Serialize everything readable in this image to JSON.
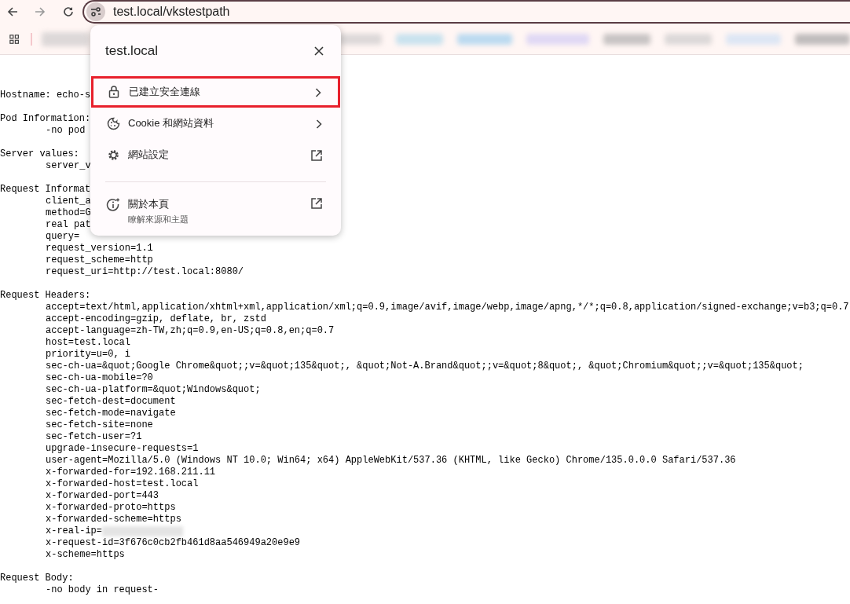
{
  "browser": {
    "url": "test.local/vkstestpath"
  },
  "page": {
    "sections": [
      {
        "heading": "Hostname: echo-s"
      },
      {
        "heading": "Pod Information:",
        "lines": [
          "-no pod"
        ]
      },
      {
        "heading": "Server values:",
        "lines": [
          "server_v"
        ]
      },
      {
        "heading": "Request Informat",
        "lines": [
          "client_a",
          "method=G",
          "real pat",
          "query=",
          "request_version=1.1",
          "request_scheme=http",
          "request_uri=http://test.local:8080/"
        ]
      },
      {
        "heading": "Request Headers:",
        "lines": [
          "accept=text/html,application/xhtml+xml,application/xml;q=0.9,image/avif,image/webp,image/apng,*/*;q=0.8,application/signed-exchange;v=b3;q=0.7",
          "accept-encoding=gzip, deflate, br, zstd",
          "accept-language=zh-TW,zh;q=0.9,en-US;q=0.8,en;q=0.7",
          "host=test.local",
          "priority=u=0, i",
          "sec-ch-ua=&quot;Google Chrome&quot;;v=&quot;135&quot;, &quot;Not-A.Brand&quot;;v=&quot;8&quot;, &quot;Chromium&quot;;v=&quot;135&quot;",
          "sec-ch-ua-mobile=?0",
          "sec-ch-ua-platform=&quot;Windows&quot;",
          "sec-fetch-dest=document",
          "sec-fetch-mode=navigate",
          "sec-fetch-site=none",
          "sec-fetch-user=?1",
          "upgrade-insecure-requests=1",
          "user-agent=Mozilla/5.0 (Windows NT 10.0; Win64; x64) AppleWebKit/537.36 (KHTML, like Gecko) Chrome/135.0.0.0 Safari/537.36",
          "x-forwarded-for=192.168.211.11",
          "x-forwarded-host=test.local",
          "x-forwarded-port=443",
          "x-forwarded-proto=https",
          "x-forwarded-scheme=https",
          "x-real-ip=",
          "x-request-id=3f676c0cb2fb461d8aa546949a20e9e9",
          "x-scheme=https"
        ]
      },
      {
        "heading": "Request Body:",
        "lines": [
          "-no body in request-"
        ]
      }
    ]
  },
  "site_popup": {
    "title": "test.local",
    "items": [
      {
        "kind": "submenu",
        "label": "已建立安全連線",
        "highlighted": true
      },
      {
        "kind": "submenu",
        "label": "Cookie 和網站資料",
        "highlighted": false
      },
      {
        "kind": "external",
        "label": "網站設定",
        "highlighted": false
      },
      {
        "kind": "divider"
      },
      {
        "kind": "external",
        "label": "關於本頁",
        "sublabel": "瞭解來源和主題",
        "highlighted": false
      }
    ]
  }
}
